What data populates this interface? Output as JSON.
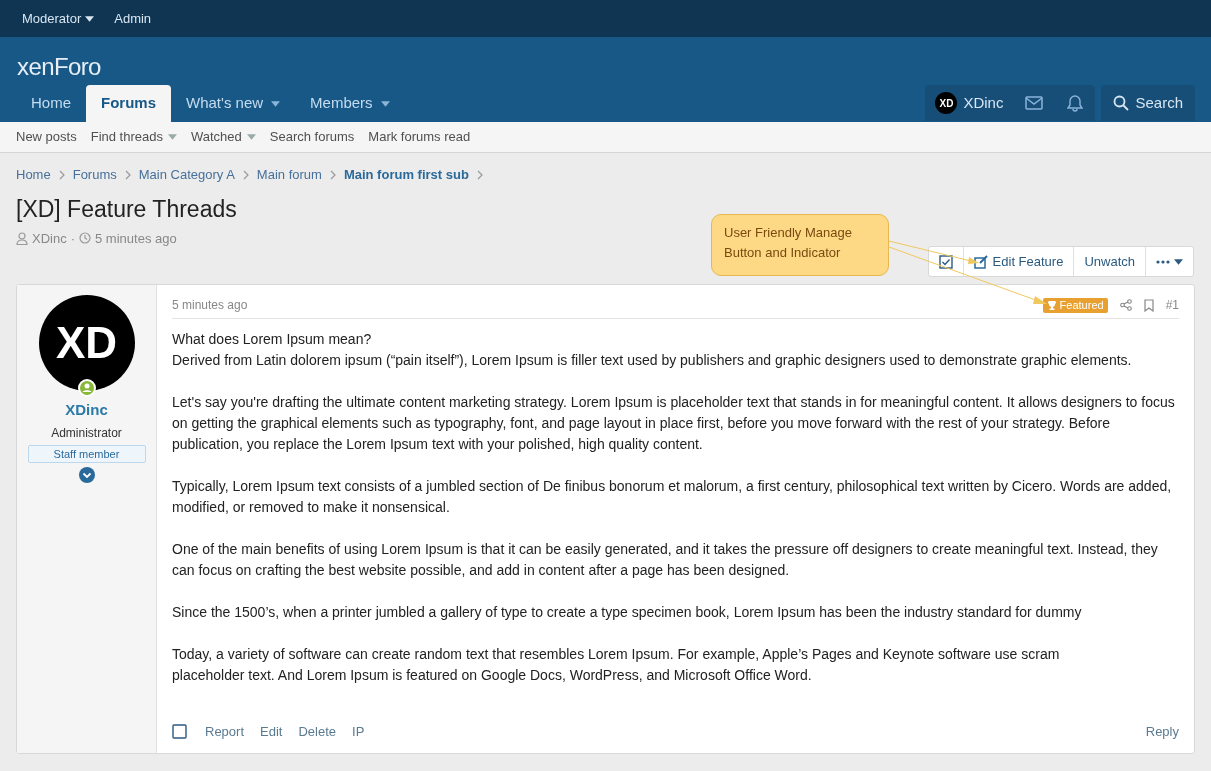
{
  "staff_bar": [
    {
      "label": "Moderator",
      "has_menu": true
    },
    {
      "label": "Admin",
      "has_menu": false
    }
  ],
  "logo": "xenForo",
  "nav_tabs": [
    {
      "label": "Home",
      "selected": false,
      "has_menu": false
    },
    {
      "label": "Forums",
      "selected": true,
      "has_menu": false
    },
    {
      "label": "What's new",
      "selected": false,
      "has_menu": true
    },
    {
      "label": "Members",
      "selected": false,
      "has_menu": true
    }
  ],
  "account": {
    "initials": "XD",
    "name": "XDinc"
  },
  "search": {
    "label": "Search"
  },
  "sub_nav": [
    {
      "label": "New posts",
      "has_menu": false
    },
    {
      "label": "Find threads",
      "has_menu": true
    },
    {
      "label": "Watched",
      "has_menu": true
    },
    {
      "label": "Search forums",
      "has_menu": false
    },
    {
      "label": "Mark forums read",
      "has_menu": false
    }
  ],
  "breadcrumbs": [
    {
      "label": "Home",
      "current": false
    },
    {
      "label": "Forums",
      "current": false
    },
    {
      "label": "Main Category A",
      "current": false
    },
    {
      "label": "Main forum",
      "current": false
    },
    {
      "label": "Main forum first sub",
      "current": true
    }
  ],
  "thread": {
    "title": "[XD] Feature Threads",
    "author": "XDinc",
    "separator": "·",
    "time": "5 minutes ago"
  },
  "annotation": "User Friendly Manage Button and Indicator",
  "thread_actions": [
    {
      "kind": "checkbox"
    },
    {
      "kind": "button",
      "label": "Edit Feature"
    },
    {
      "kind": "button",
      "label": "Unwatch"
    },
    {
      "kind": "menu"
    }
  ],
  "post": {
    "time": "5 minutes ago",
    "featured_badge": "Featured",
    "number": "#1",
    "user": {
      "initials": "XD",
      "name": "XDinc",
      "role": "Administrator",
      "banner": "Staff member",
      "online": true
    },
    "paragraphs": [
      [
        "What does Lorem Ipsum mean?",
        "Derived from Latin dolorem ipsum (“pain itself”), Lorem Ipsum is filler text used by publishers and graphic designers used to demonstrate graphic elements."
      ],
      [
        "Let's say you're drafting the ultimate content marketing strategy. Lorem Ipsum is placeholder text that stands in for meaningful content. It allows designers to focus on getting the graphical elements such as typography, font, and page layout in place first, before you move forward with the rest of your strategy. Before publication, you replace the Lorem Ipsum text with your polished, high quality content."
      ],
      [
        "Typically, Lorem Ipsum text consists of a jumbled section of De finibus bonorum et malorum, a first century, philosophical text written by Cicero. Words are added, modified, or removed to make it nonsensical."
      ],
      [
        "One of the main benefits of using Lorem Ipsum is that it can be easily generated, and it takes the pressure off designers to create meaningful text. Instead, they can focus on crafting the best website possible, and add in content after a page has been designed."
      ],
      [
        "Since the 1500’s, when a printer jumbled a gallery of type to create a type specimen book, Lorem Ipsum has been the industry standard for dummy"
      ],
      [
        "Today, a variety of software can create random text that resembles Lorem Ipsum. For example, Apple’s Pages and Keynote software use scram",
        "placeholder text. And Lorem Ipsum is featured on Google Docs, WordPress, and Microsoft Office Word."
      ]
    ],
    "select_checked": false,
    "footer_actions": [
      "Report",
      "Edit",
      "Delete",
      "IP"
    ],
    "reply": "Reply"
  }
}
